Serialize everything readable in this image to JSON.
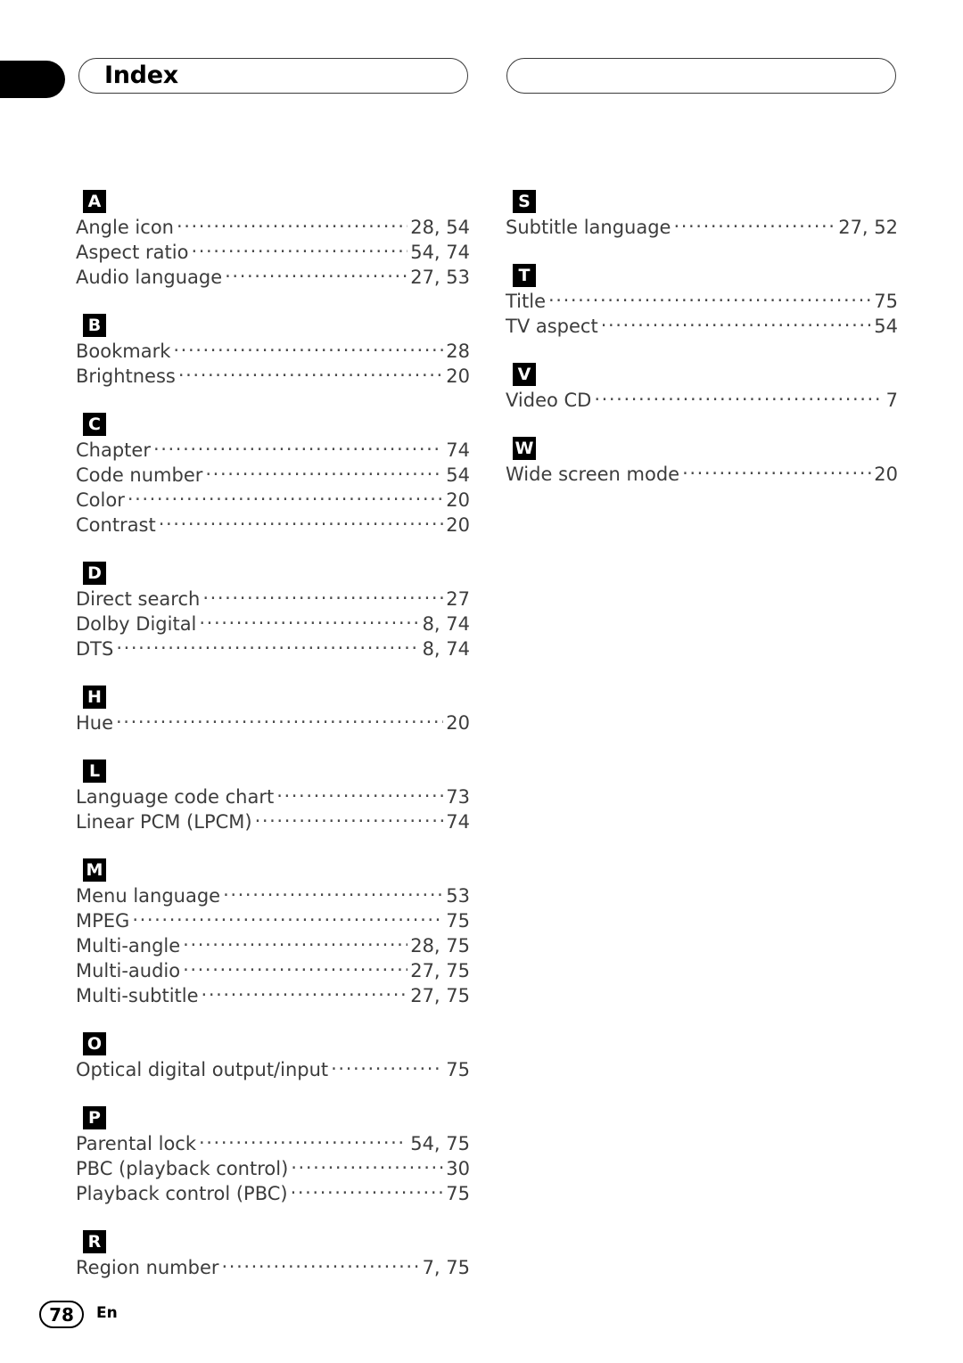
{
  "header": {
    "title": "Index",
    "left_box_empty_label": "",
    "right_box_empty_label": ""
  },
  "footer": {
    "page_number": "78",
    "language_code": "En"
  },
  "columns": [
    {
      "name": "left-column",
      "sections": [
        {
          "letter": "A",
          "entries": [
            {
              "term": "Angle icon",
              "pages": "28, 54"
            },
            {
              "term": "Aspect ratio",
              "pages": "54, 74"
            },
            {
              "term": "Audio language",
              "pages": "27, 53"
            }
          ]
        },
        {
          "letter": "B",
          "entries": [
            {
              "term": "Bookmark",
              "pages": "28"
            },
            {
              "term": "Brightness",
              "pages": "20"
            }
          ]
        },
        {
          "letter": "C",
          "entries": [
            {
              "term": "Chapter",
              "pages": "74"
            },
            {
              "term": "Code number",
              "pages": "54"
            },
            {
              "term": "Color",
              "pages": "20"
            },
            {
              "term": "Contrast",
              "pages": "20"
            }
          ]
        },
        {
          "letter": "D",
          "entries": [
            {
              "term": "Direct search",
              "pages": "27"
            },
            {
              "term": "Dolby Digital",
              "pages": "8, 74"
            },
            {
              "term": "DTS",
              "pages": "8, 74"
            }
          ]
        },
        {
          "letter": "H",
          "entries": [
            {
              "term": "Hue",
              "pages": "20"
            }
          ]
        },
        {
          "letter": "L",
          "entries": [
            {
              "term": "Language code chart",
              "pages": "73"
            },
            {
              "term": "Linear PCM (LPCM)",
              "pages": "74"
            }
          ]
        },
        {
          "letter": "M",
          "entries": [
            {
              "term": "Menu language",
              "pages": "53"
            },
            {
              "term": "MPEG",
              "pages": "75"
            },
            {
              "term": "Multi-angle",
              "pages": "28, 75"
            },
            {
              "term": "Multi-audio",
              "pages": "27, 75"
            },
            {
              "term": "Multi-subtitle",
              "pages": "27, 75"
            }
          ]
        },
        {
          "letter": "O",
          "entries": [
            {
              "term": "Optical digital output/input",
              "pages": "75"
            }
          ]
        },
        {
          "letter": "P",
          "entries": [
            {
              "term": "Parental lock",
              "pages": "54, 75"
            },
            {
              "term": "PBC (playback control)",
              "pages": "30"
            },
            {
              "term": "Playback control (PBC)",
              "pages": "75"
            }
          ]
        },
        {
          "letter": "R",
          "entries": [
            {
              "term": "Region number",
              "pages": "7, 75"
            }
          ]
        }
      ]
    },
    {
      "name": "right-column",
      "sections": [
        {
          "letter": "S",
          "entries": [
            {
              "term": "Subtitle language",
              "pages": "27, 52"
            }
          ]
        },
        {
          "letter": "T",
          "entries": [
            {
              "term": "Title",
              "pages": "75"
            },
            {
              "term": "TV aspect",
              "pages": "54"
            }
          ]
        },
        {
          "letter": "V",
          "entries": [
            {
              "term": "Video CD",
              "pages": "7"
            }
          ]
        },
        {
          "letter": "W",
          "entries": [
            {
              "term": "Wide screen mode",
              "pages": "20"
            }
          ]
        }
      ]
    }
  ]
}
